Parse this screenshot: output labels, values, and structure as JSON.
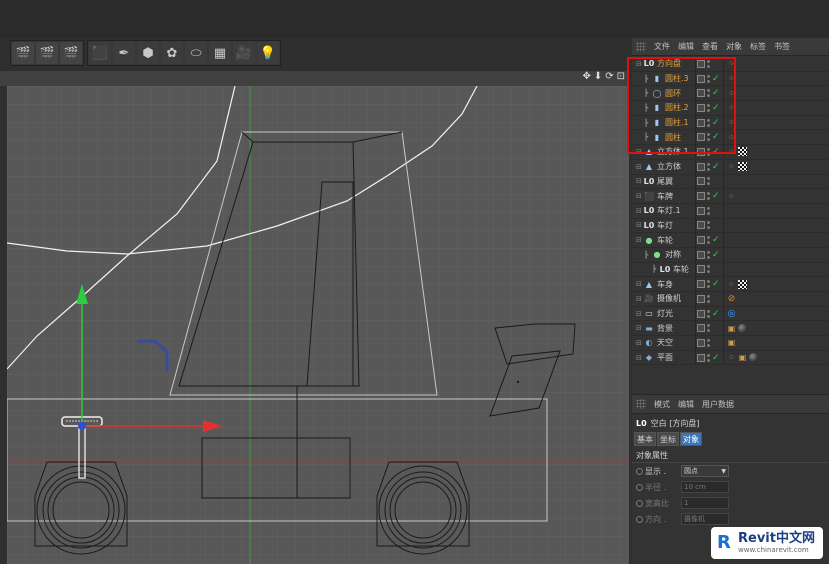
{
  "toolbar": {
    "groups": [
      [
        {
          "name": "render-view-button",
          "glyph": "🎬"
        },
        {
          "name": "render-picture-viewer-button",
          "glyph": "🎬"
        },
        {
          "name": "render-settings-button",
          "glyph": "🎬"
        }
      ],
      [
        {
          "name": "cube-button",
          "glyph": "⬛"
        },
        {
          "name": "pen-spline-button",
          "glyph": "✒"
        },
        {
          "name": "subdivision-surface-button",
          "glyph": "⬢"
        },
        {
          "name": "cloner-button",
          "glyph": "✿"
        },
        {
          "name": "deformer-button",
          "glyph": "⬭"
        },
        {
          "name": "floor-scene-button",
          "glyph": "▦"
        },
        {
          "name": "camera-button",
          "glyph": "🎥"
        },
        {
          "name": "light-button",
          "glyph": "💡"
        }
      ]
    ]
  },
  "viewport": {
    "nav_icons": [
      "✥",
      "⬇",
      "⟳",
      "⊡"
    ]
  },
  "object_manager": {
    "menu": [
      "文件",
      "编辑",
      "查看",
      "对象",
      "标签",
      "书签"
    ],
    "rows": [
      {
        "label": "方向盘",
        "indent": 0,
        "icon": "L0",
        "icon_color": "#e0e0e0",
        "selected": true,
        "check": false,
        "tags": [
          "orange-dots"
        ]
      },
      {
        "label": "圆柱.3",
        "indent": 1,
        "icon": "▮",
        "icon_color": "#9bc7f0",
        "selected": true,
        "check": true,
        "tags": [
          "orange-dots"
        ]
      },
      {
        "label": "圆环",
        "indent": 1,
        "icon": "◯",
        "icon_color": "#9bc7f0",
        "selected": true,
        "check": true,
        "tags": [
          "orange-dots"
        ]
      },
      {
        "label": "圆柱.2",
        "indent": 1,
        "icon": "▮",
        "icon_color": "#9bc7f0",
        "selected": true,
        "check": true,
        "tags": [
          "orange-dots"
        ]
      },
      {
        "label": "圆柱.1",
        "indent": 1,
        "icon": "▮",
        "icon_color": "#9bc7f0",
        "selected": true,
        "check": true,
        "tags": [
          "orange-dots"
        ]
      },
      {
        "label": "圆柱",
        "indent": 1,
        "icon": "▮",
        "icon_color": "#9bc7f0",
        "selected": true,
        "check": true,
        "tags": [
          "orange-dots"
        ]
      },
      {
        "label": "立方体.1",
        "indent": 0,
        "icon": "▲",
        "icon_color": "#9bc7f0",
        "selected": false,
        "check": true,
        "tags": [
          "orange-dots",
          "checker"
        ]
      },
      {
        "label": "立方体",
        "indent": 0,
        "icon": "▲",
        "icon_color": "#9bc7f0",
        "selected": false,
        "check": true,
        "tags": [
          "orange-dots",
          "checker"
        ]
      },
      {
        "label": "尾翼",
        "indent": 0,
        "icon": "L0",
        "icon_color": "#e0e0e0",
        "selected": false,
        "check": false,
        "tags": []
      },
      {
        "label": "车牌",
        "indent": 0,
        "icon": "⬛",
        "icon_color": "#5aa0e0",
        "selected": false,
        "check": true,
        "tags": [
          "orange-dots"
        ]
      },
      {
        "label": "车灯.1",
        "indent": 0,
        "icon": "L0",
        "icon_color": "#e0e0e0",
        "selected": false,
        "check": false,
        "tags": []
      },
      {
        "label": "车灯",
        "indent": 0,
        "icon": "L0",
        "icon_color": "#e0e0e0",
        "selected": false,
        "check": false,
        "tags": []
      },
      {
        "label": "车轮",
        "indent": 0,
        "icon": "●",
        "icon_color": "#7fe08a",
        "selected": false,
        "check": true,
        "tags": []
      },
      {
        "label": "对称",
        "indent": 1,
        "icon": "●",
        "icon_color": "#7fe08a",
        "selected": false,
        "check": true,
        "tags": []
      },
      {
        "label": "车轮",
        "indent": 2,
        "icon": "L0",
        "icon_color": "#e0e0e0",
        "selected": false,
        "check": false,
        "tags": []
      },
      {
        "label": "车身",
        "indent": 0,
        "icon": "▲",
        "icon_color": "#9bc7f0",
        "selected": false,
        "check": true,
        "tags": [
          "orange-dots",
          "checker"
        ]
      },
      {
        "label": "摄像机",
        "indent": 0,
        "icon": "🎥",
        "icon_color": "#e0e0e0",
        "selected": false,
        "check": false,
        "tags": [
          "no-sign"
        ]
      },
      {
        "label": "灯光",
        "indent": 0,
        "icon": "▭",
        "icon_color": "#e0e0e0",
        "selected": false,
        "check": true,
        "tags": [
          "target"
        ]
      },
      {
        "label": "背景",
        "indent": 0,
        "icon": "▬",
        "icon_color": "#7fb0e0",
        "selected": false,
        "check": false,
        "tags": [
          "clapper",
          "sphere"
        ]
      },
      {
        "label": "天空",
        "indent": 0,
        "icon": "◐",
        "icon_color": "#7fb0e0",
        "selected": false,
        "check": false,
        "tags": [
          "clapper"
        ]
      },
      {
        "label": "平面",
        "indent": 0,
        "icon": "◆",
        "icon_color": "#7fb0e0",
        "selected": false,
        "check": true,
        "tags": [
          "orange-dots",
          "clapper",
          "sphere"
        ]
      }
    ]
  },
  "attributes": {
    "menu": [
      "模式",
      "编辑",
      "用户数据"
    ],
    "title_icon": "L0",
    "title": "空白 [方向盘]",
    "tabs": [
      {
        "label": "基本",
        "active": false
      },
      {
        "label": "坐标",
        "active": false
      },
      {
        "label": "对象",
        "active": true
      }
    ],
    "section": "对象属性",
    "props": [
      {
        "label": "显示 .",
        "value": "圆点",
        "enabled": true,
        "dropdown": true
      },
      {
        "label": "半径 .",
        "value": "10 cm",
        "enabled": false,
        "dropdown": false
      },
      {
        "label": "宽高比",
        "value": "1",
        "enabled": false,
        "dropdown": false
      },
      {
        "label": "方向 .",
        "value": "摄像机",
        "enabled": false,
        "dropdown": false
      }
    ]
  },
  "watermark": {
    "brand": "Revit中文网",
    "url": "www.chinarevit.com"
  },
  "colors": {
    "selected_label": "#e8a33a",
    "highlight_box": "#e01010",
    "check": "#2fd24a",
    "active_tab": "#3c76b8",
    "viewport_bg": "#585858"
  }
}
